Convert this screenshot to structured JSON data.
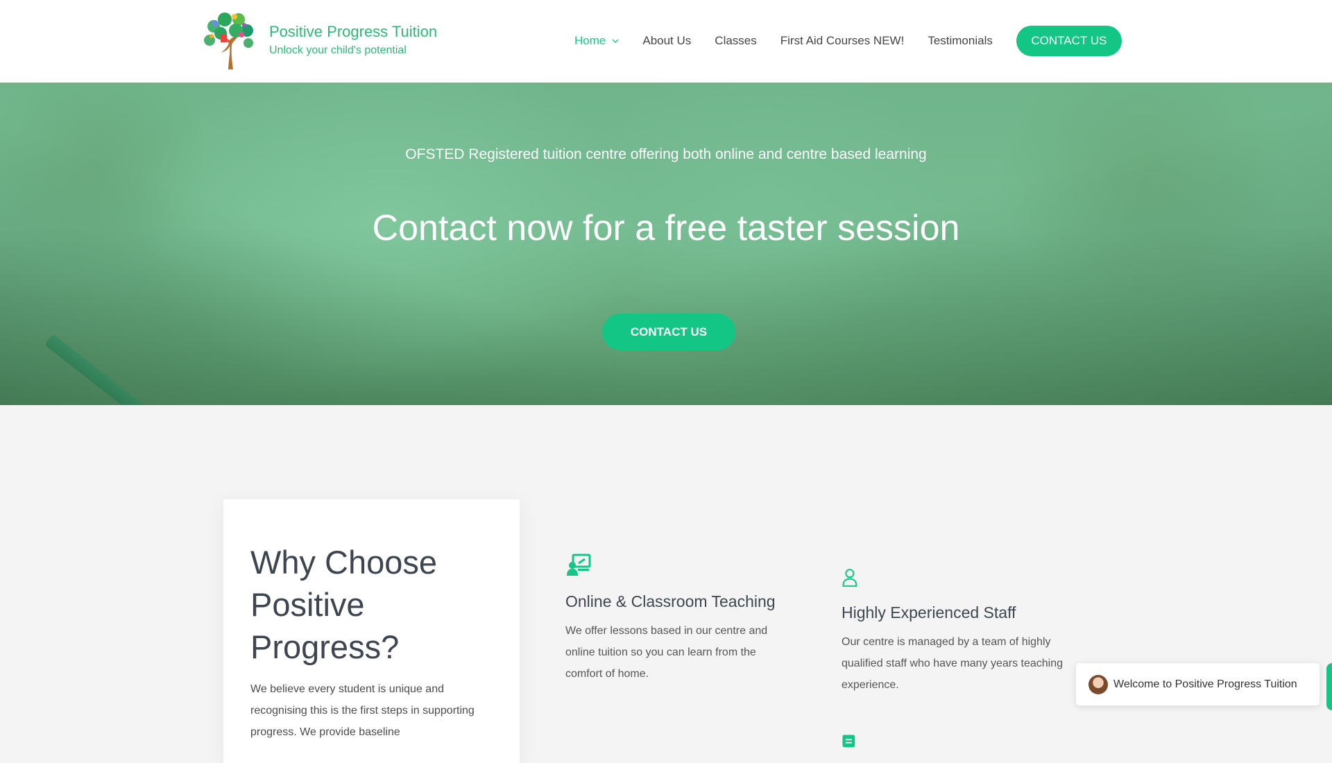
{
  "header": {
    "brand_title": "Positive Progress Tuition",
    "brand_tagline": "Unlock your child's potential",
    "nav": [
      {
        "label": "Home",
        "active": true,
        "has_dropdown": true
      },
      {
        "label": "About Us"
      },
      {
        "label": "Classes"
      },
      {
        "label": "First Aid Courses NEW!"
      },
      {
        "label": "Testimonials"
      }
    ],
    "cta_label": "CONTACT US"
  },
  "hero": {
    "subtitle": "OFSTED Registered tuition centre offering both online and centre based learning",
    "title": "Contact now for a free taster session",
    "cta_label": "CONTACT US"
  },
  "why": {
    "title": "Why Choose Positive Progress?",
    "text": "We believe every student is unique and recognising this is the first steps in supporting progress. We provide baseline"
  },
  "features": [
    {
      "icon": "teacher-board-icon",
      "title": "Online & Classroom Teaching",
      "text": "We offer lessons based in our centre and online tuition so you can learn from the comfort of home."
    },
    {
      "icon": "person-icon",
      "title": "Highly Experienced Staff",
      "text": "Our centre is managed by a team of highly qualified staff who have many years teaching experience."
    },
    {
      "icon": "document-icon"
    }
  ],
  "chat": {
    "text": "Welcome to Positive Progress Tuition"
  },
  "colors": {
    "accent": "#13c685",
    "brand": "#2fb779",
    "text": "#3d4550"
  }
}
